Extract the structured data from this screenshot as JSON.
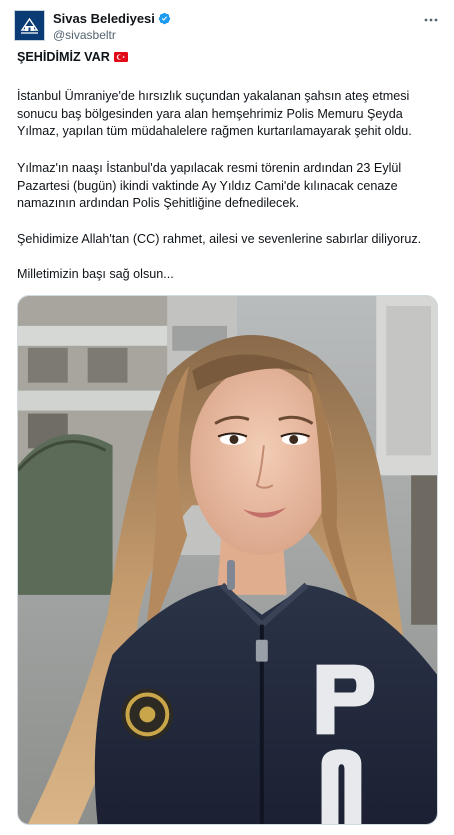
{
  "account": {
    "display_name": "Sivas Belediyesi",
    "handle": "@sivasbeltr",
    "verified": true,
    "avatar_icon": "municipality-logo-icon",
    "verified_icon": "verified-badge-icon",
    "more_icon": "more-options-icon"
  },
  "post": {
    "headline": "ŞEHİDİMİZ VAR",
    "headline_emoji": "turkey-flag-icon",
    "paragraph_1": "İstanbul Ümraniye'de hırsızlık suçundan yakalanan şahsın ateş etmesi sonucu baş bölgesinden yara alan hemşehrimiz Polis Memuru Şeyda Yılmaz, yapılan tüm müdahalelere rağmen kurtarılamayarak şehit oldu.",
    "paragraph_2": "Yılmaz'ın naaşı İstanbul'da yapılacak resmi törenin ardından 23 Eylül Pazartesi (bugün) ikindi vaktinde Ay Yıldız Cami'de kılınacak cenaze namazının ardından Polis Şehitliğine defnedilecek.",
    "paragraph_3": "Şehidimize Allah'tan (CC) rahmet, ailesi ve sevenlerine sabırlar diliyoruz.",
    "paragraph_4": "Milletimizin başı sağ olsun..."
  },
  "colors": {
    "brand_blue": "#0b3b74",
    "verified_blue": "#1d9bf0",
    "flag_red": "#e30a17",
    "secondary_text": "#536471"
  }
}
